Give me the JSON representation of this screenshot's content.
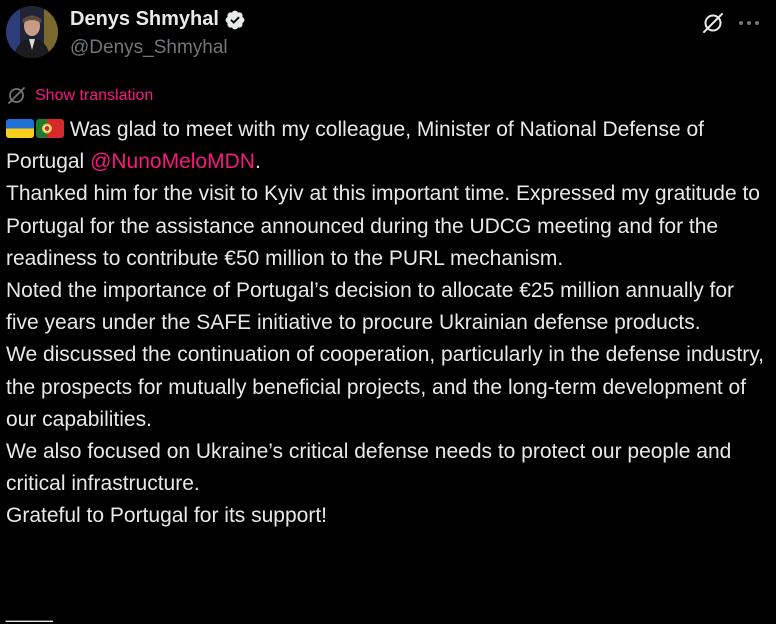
{
  "author": {
    "display_name": "Denys Shmyhal",
    "handle": "@Denys_Shmyhal",
    "verified": true
  },
  "icons": {
    "avatar": "profile-avatar",
    "verified": "verified-badge-icon",
    "grok": "grok-icon",
    "more": "more-icon",
    "translate": "translate-icon",
    "flag_ukraine": "ukraine-flag-icon",
    "flag_portugal": "portugal-flag-icon"
  },
  "translation": {
    "label": "Show translation"
  },
  "tweet": {
    "line1_text": " Was glad to meet with my colleague, Minister of National Defense of Portugal ",
    "mention": "@NunoMeloMDN",
    "line1_end": ".",
    "body": "Thanked him for the visit to Kyiv at this important time. Expressed my gratitude to Portugal for the assistance announced during the UDCG meeting and for the readiness to contribute €50 million to the PURL mechanism.\nNoted the importance of Portugal’s decision to allocate €25 million annually for five years under the SAFE initiative to procure Ukrainian defense products.\nWe discussed the continuation of cooperation, particularly in the defense industry, the prospects for mutually beneficial projects, and the long-term development of our capabilities.\nWe also focused on Ukraine’s critical defense needs to protect our people and critical infrastructure.\nGrateful to Portugal for its support!",
    "trailing": "____"
  },
  "colors": {
    "background": "#000000",
    "text": "#e7e9ea",
    "muted": "#71767b",
    "accent": "#f91880",
    "verified": "#e7e9ea"
  }
}
